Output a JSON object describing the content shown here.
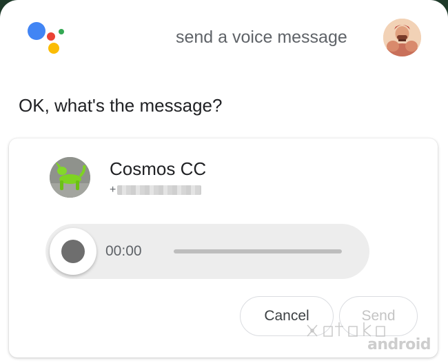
{
  "assistant": {
    "logo_icon": "google-assistant-icon",
    "query": "send a voice message",
    "user_avatar_icon": "user-avatar",
    "prompt": "OK, what's the message?"
  },
  "contact": {
    "name": "Cosmos CC",
    "number_prefix": "+",
    "avatar_icon": "contact-avatar"
  },
  "recorder": {
    "timer": "00:00",
    "progress": 0,
    "record_icon": "record-icon"
  },
  "actions": {
    "cancel_label": "Cancel",
    "send_label": "Send"
  },
  "watermark": {
    "text": "android"
  },
  "colors": {
    "blue": "#4285F4",
    "red": "#EA4335",
    "yellow": "#FBBC05",
    "green": "#34A853"
  }
}
